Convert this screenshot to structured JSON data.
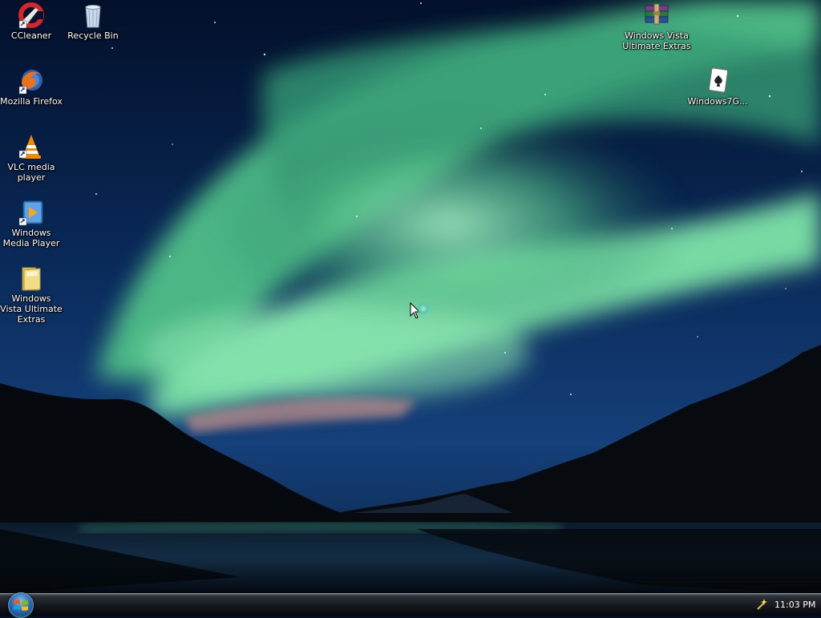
{
  "desktop": {
    "icons": [
      {
        "label": "CCleaner",
        "icon": "ccleaner-icon"
      },
      {
        "label": "Recycle Bin",
        "icon": "recycle-bin-icon"
      },
      {
        "label": "Mozilla Firefox",
        "icon": "firefox-icon"
      },
      {
        "label": "VLC media player",
        "icon": "vlc-icon"
      },
      {
        "label": "Windows Media Player",
        "icon": "windows-media-player-icon"
      },
      {
        "label": "Windows Vista Ultimate Extras",
        "icon": "folder-icon"
      },
      {
        "label": "Windows Vista Ultimate Extras",
        "icon": "winrar-archive-icon"
      },
      {
        "label": "Windows7G...",
        "icon": "solitaire-card-icon"
      }
    ]
  },
  "taskbar": {
    "clock": "11:03 PM",
    "start_icon": "windows-logo-icon",
    "tray_icon": "notification-wand-icon"
  },
  "colors": {
    "sky_dark": "#041838",
    "aurora_green": "#6fe0a0",
    "taskbar": "#14171b"
  }
}
